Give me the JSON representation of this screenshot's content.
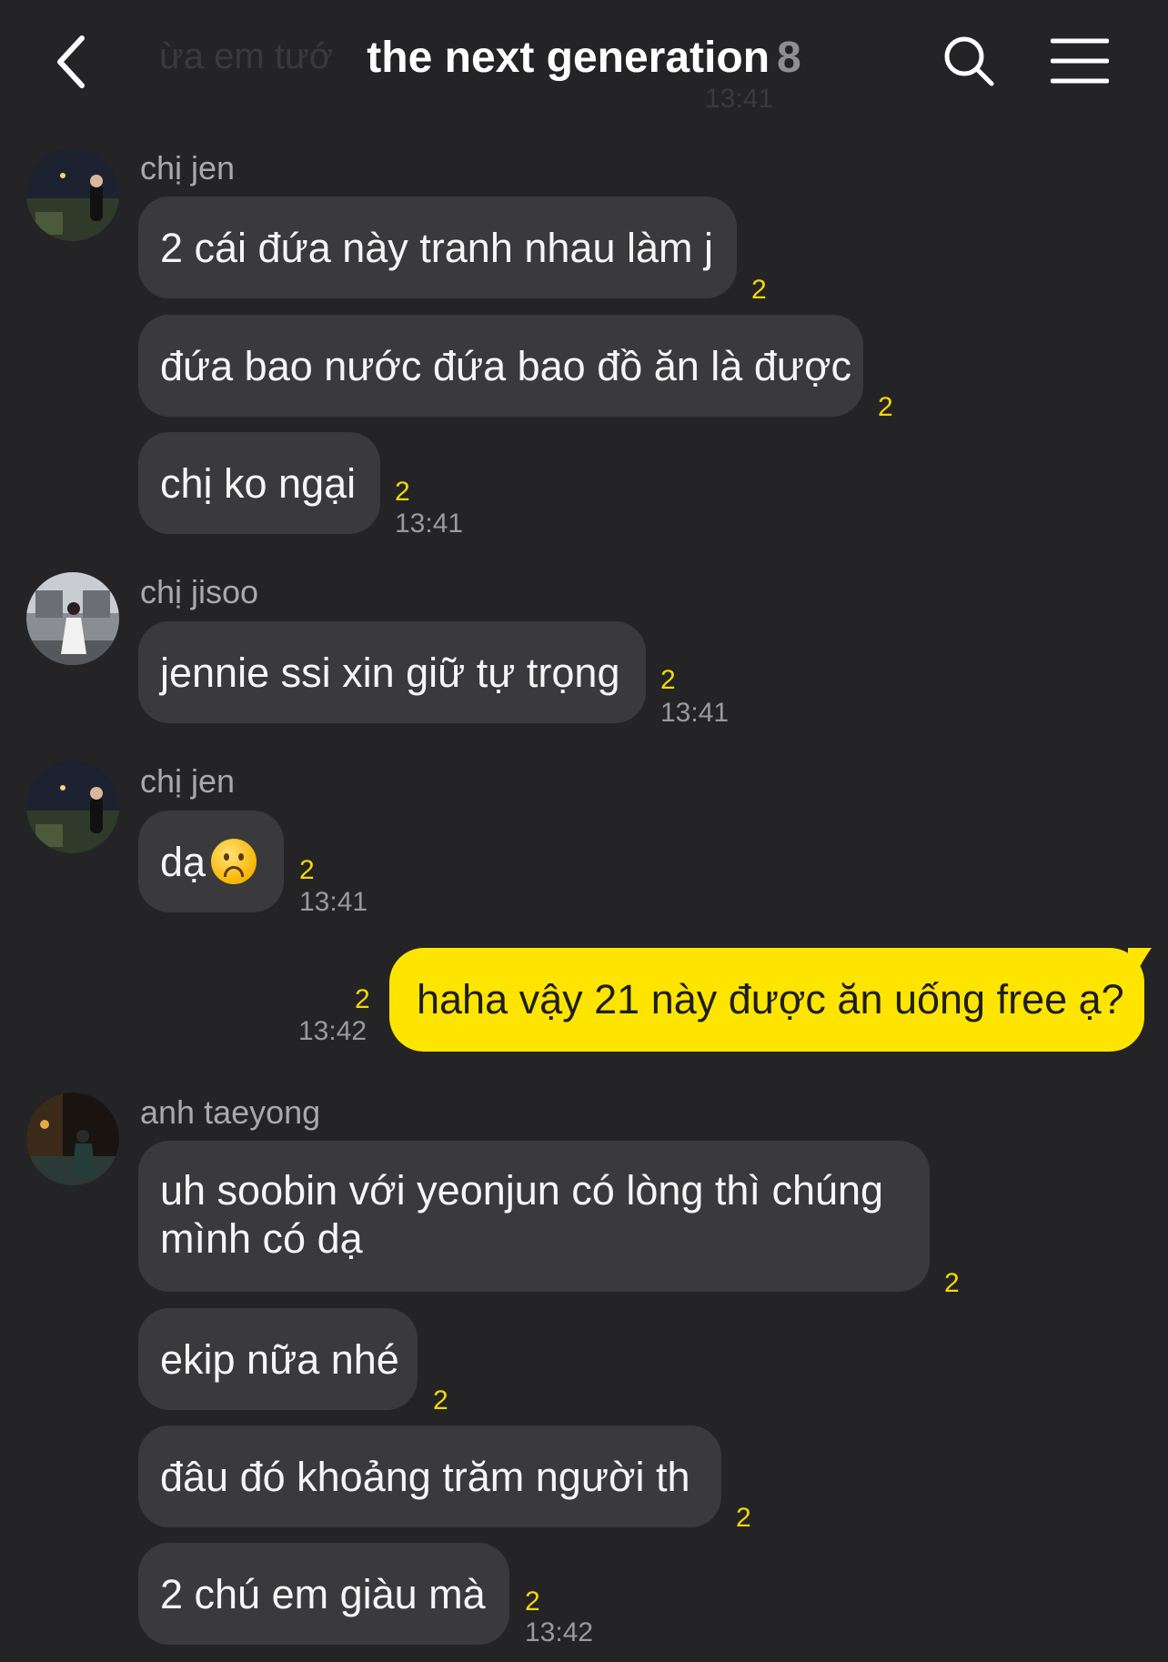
{
  "header": {
    "title": "the next generation",
    "member_count": "8",
    "ghost_text": "ừa em tướ",
    "ghost_time": "13:41"
  },
  "messages": [
    {
      "sender": "chị jen",
      "bubbles": [
        {
          "text": "2 cái đứa này tranh nhau làm j",
          "count": "2"
        },
        {
          "text": "đứa bao nước đứa bao đồ ăn là được",
          "count": "2"
        },
        {
          "text": "chị ko ngại",
          "count": "2",
          "time": "13:41"
        }
      ]
    },
    {
      "sender": "chị jisoo",
      "bubbles": [
        {
          "text": "jennie ssi xin giữ tự trọng",
          "count": "2",
          "time": "13:41"
        }
      ]
    },
    {
      "sender": "chị jen",
      "bubbles": [
        {
          "text": "dạ",
          "count": "2",
          "time": "13:41",
          "emoji": "frowning-face"
        }
      ]
    },
    {
      "sender": "me",
      "bubbles": [
        {
          "text": "haha vậy 21 này được ăn uống free ạ?",
          "count": "2",
          "time": "13:42"
        }
      ]
    },
    {
      "sender": "anh taeyong",
      "bubbles": [
        {
          "text": "uh soobin với yeonjun có lòng thì chúng mình có dạ",
          "count": "2"
        },
        {
          "text": "ekip nữa nhé",
          "count": "2"
        },
        {
          "text": "đâu đó khoảng trăm người th",
          "count": "2"
        },
        {
          "text": "2 chú em giàu mà",
          "count": "2",
          "time": "13:42"
        }
      ]
    }
  ],
  "colors": {
    "background": "#242426",
    "other_bubble": "#3a3a3c",
    "my_bubble": "#fee500",
    "unread_count": "#f5d60a"
  }
}
